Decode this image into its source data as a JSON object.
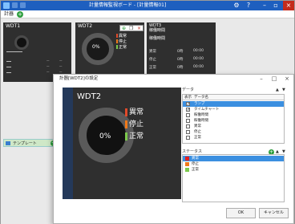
{
  "app": {
    "title": "計量情報監視ボード - [計量情報01]",
    "colors": {
      "titlebar": "#1e5fbf",
      "accent": "#2e9e3e"
    }
  },
  "menubar": {
    "menu_label": "計器",
    "add_icon": "plus-circle-icon"
  },
  "widgets": {
    "wdt1": {
      "title": "WDT1"
    },
    "wdt2": {
      "title": "WDT2",
      "value": "0%",
      "legend": [
        "異常",
        "停止",
        "正常"
      ]
    },
    "wdt3": {
      "title_lines": [
        "WDT3",
        "稼働時間",
        "稼働時間"
      ],
      "rows": [
        {
          "label": "異常",
          "value": "0時",
          "unit": "00:00"
        },
        {
          "label": "停止",
          "value": "0時",
          "unit": "00:00"
        },
        {
          "label": "正常",
          "value": "0時",
          "unit": "00:00"
        }
      ]
    }
  },
  "template_bar": {
    "label": "テンプレート"
  },
  "dialog": {
    "title": "計器[WDT2]の設定",
    "preview": {
      "title": "WDT2",
      "value": "0%",
      "legend": [
        {
          "label": "異常",
          "color": "#e04a2a"
        },
        {
          "label": "停止",
          "color": "#f07a1a"
        },
        {
          "label": "正常",
          "color": "#7cc94c"
        }
      ]
    },
    "data_section": {
      "label": "データ",
      "header": {
        "display": "表示",
        "name": "データ名"
      },
      "rows": [
        {
          "name": "ランプ",
          "checked": true,
          "selected": true
        },
        {
          "name": "タイムチャート",
          "checked": true,
          "selected": false
        },
        {
          "name": "稼働時間",
          "checked": false,
          "selected": false
        },
        {
          "name": "稼働時間",
          "checked": false,
          "selected": false
        },
        {
          "name": "異常",
          "checked": false,
          "selected": false
        },
        {
          "name": "停止",
          "checked": false,
          "selected": false
        },
        {
          "name": "正常",
          "checked": false,
          "selected": false
        }
      ]
    },
    "status_section": {
      "label": "ステータス",
      "rows": [
        {
          "name": "異常",
          "color": "#e02020",
          "selected": true
        },
        {
          "name": "停止",
          "color": "#f07a1a",
          "selected": false
        },
        {
          "name": "正常",
          "color": "#7cc94c",
          "selected": false
        }
      ]
    },
    "ok_label": "OK",
    "cancel_label": "キャンセル"
  }
}
